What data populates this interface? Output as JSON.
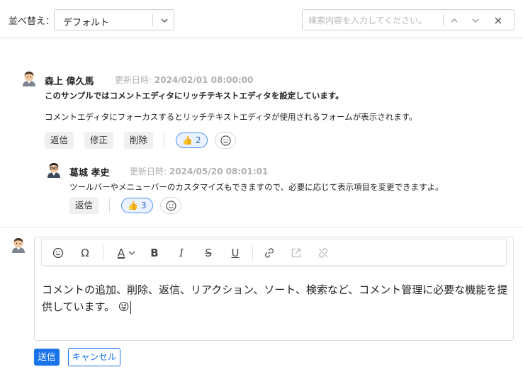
{
  "sort": {
    "label": "並べ替え：",
    "value": "デフォルト"
  },
  "search": {
    "placeholder": "検索内容を入力してください。",
    "value": ""
  },
  "comments": [
    {
      "author": "森上 偉久馬",
      "updated_label": "更新日時:",
      "updated_at": "2024/02/01 08:00:00",
      "lines": [
        "このサンプルではコメントエディタにリッチテキストエディタを設定しています。",
        "コメントエディタにフォーカスするとリッチテキストエディタが使用されるフォームが表示されます。"
      ],
      "actions": [
        "返信",
        "修正",
        "削除"
      ],
      "reaction": {
        "emoji": "👍",
        "count": "2"
      },
      "replies": [
        {
          "author": "葛城 孝史",
          "updated_label": "更新日時:",
          "updated_at": "2024/05/20 08:01:01",
          "lines": [
            "ツールバーやメニューバーのカスタマイズもできますので、必要に応じて表示項目を変更できますよ。"
          ],
          "actions": [
            "返信"
          ],
          "reaction": {
            "emoji": "👍",
            "count": "3"
          }
        }
      ]
    }
  ],
  "editor": {
    "content": "コメントの追加、削除、返信、リアクション、ソート、検索など、コメント管理に必要な機能を提供しています。",
    "emoji": "😜",
    "toolbar": {
      "emoji": "emoji-icon",
      "special_char": "Ω",
      "font_color": "A",
      "bold": "B",
      "italic": "I",
      "strikethrough": "S",
      "underline": "U",
      "link": "link-icon",
      "open_link": "open-link-icon",
      "unlink": "unlink-icon"
    }
  },
  "buttons": {
    "send": "送信",
    "cancel": "キャンセル"
  },
  "colors": {
    "accent": "#1a73e8",
    "reaction_bg": "#eaf2ff",
    "muted": "#b0b0b0"
  }
}
